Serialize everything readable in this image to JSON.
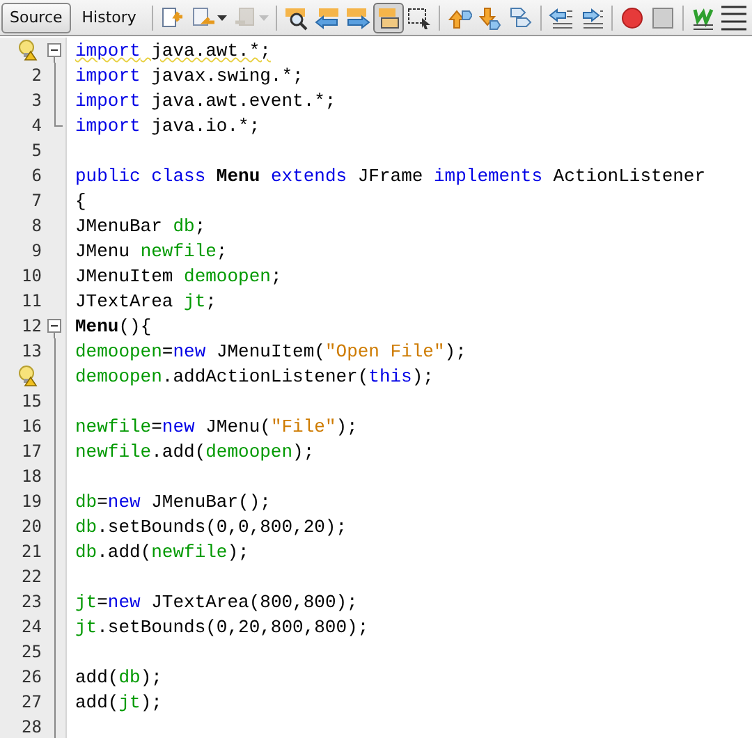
{
  "tabs": [
    {
      "label": "Source",
      "selected": true
    },
    {
      "label": "History",
      "selected": false
    }
  ],
  "toolbar": [
    {
      "kind": "button",
      "disabled": false,
      "selected": false
    },
    {
      "kind": "dropdown",
      "disabled": false,
      "selected": false
    },
    {
      "kind": "dropdown",
      "disabled": true,
      "selected": false
    },
    {
      "kind": "separator"
    },
    {
      "kind": "button",
      "disabled": false,
      "selected": false
    },
    {
      "kind": "button",
      "disabled": false,
      "selected": false
    },
    {
      "kind": "button",
      "disabled": false,
      "selected": false
    },
    {
      "kind": "button",
      "disabled": false,
      "selected": true
    },
    {
      "kind": "button",
      "disabled": false,
      "selected": false
    },
    {
      "kind": "separator"
    },
    {
      "kind": "button",
      "disabled": false,
      "selected": false
    },
    {
      "kind": "button",
      "disabled": false,
      "selected": false
    },
    {
      "kind": "button",
      "disabled": false,
      "selected": false
    },
    {
      "kind": "separator"
    },
    {
      "kind": "button",
      "disabled": false,
      "selected": false
    },
    {
      "kind": "button",
      "disabled": false,
      "selected": false
    },
    {
      "kind": "separator"
    },
    {
      "kind": "button",
      "disabled": false,
      "selected": false
    },
    {
      "kind": "button",
      "disabled": false,
      "selected": false
    },
    {
      "kind": "separator"
    },
    {
      "kind": "button",
      "disabled": false,
      "selected": false
    },
    {
      "kind": "button",
      "disabled": false,
      "selected": false
    }
  ],
  "lines": [
    {
      "hint": true,
      "fold_open": true,
      "warning": true,
      "tokens": [
        {
          "kind": "keyword",
          "text": "import"
        },
        {
          "kind": "plain",
          "text": " java.awt.*;"
        }
      ]
    },
    {
      "number": "2",
      "fold_guide": true,
      "tokens": [
        {
          "kind": "keyword",
          "text": "import"
        },
        {
          "kind": "plain",
          "text": " javax.swing.*;"
        }
      ]
    },
    {
      "number": "3",
      "fold_guide": true,
      "tokens": [
        {
          "kind": "keyword",
          "text": "import"
        },
        {
          "kind": "plain",
          "text": " java.awt.event.*;"
        }
      ]
    },
    {
      "number": "4",
      "fold_end": true,
      "tokens": [
        {
          "kind": "keyword",
          "text": "import"
        },
        {
          "kind": "plain",
          "text": " java.io.*;"
        }
      ]
    },
    {
      "number": "5"
    },
    {
      "number": "6",
      "tokens": [
        {
          "kind": "keyword",
          "text": "public class "
        },
        {
          "kind": "bold",
          "text": "Menu"
        },
        {
          "kind": "keyword",
          "text": " extends"
        },
        {
          "kind": "plain",
          "text": " JFrame "
        },
        {
          "kind": "keyword",
          "text": "implements"
        },
        {
          "kind": "plain",
          "text": " ActionListener"
        }
      ]
    },
    {
      "number": "7",
      "tokens": [
        {
          "kind": "plain",
          "text": "{"
        }
      ]
    },
    {
      "number": "8",
      "tokens": [
        {
          "kind": "plain",
          "text": "JMenuBar "
        },
        {
          "kind": "field",
          "text": "db"
        },
        {
          "kind": "plain",
          "text": ";"
        }
      ]
    },
    {
      "number": "9",
      "tokens": [
        {
          "kind": "plain",
          "text": "JMenu "
        },
        {
          "kind": "field",
          "text": "newfile"
        },
        {
          "kind": "plain",
          "text": ";"
        }
      ]
    },
    {
      "number": "10",
      "tokens": [
        {
          "kind": "plain",
          "text": "JMenuItem "
        },
        {
          "kind": "field",
          "text": "demoopen"
        },
        {
          "kind": "plain",
          "text": ";"
        }
      ]
    },
    {
      "number": "11",
      "tokens": [
        {
          "kind": "plain",
          "text": "JTextArea "
        },
        {
          "kind": "field",
          "text": "jt"
        },
        {
          "kind": "plain",
          "text": ";"
        }
      ]
    },
    {
      "number": "12",
      "fold_open": true,
      "tokens": [
        {
          "kind": "bold",
          "text": "Menu"
        },
        {
          "kind": "plain",
          "text": "(){"
        }
      ]
    },
    {
      "number": "13",
      "fold_guide": true,
      "tokens": [
        {
          "kind": "field",
          "text": "demoopen"
        },
        {
          "kind": "plain",
          "text": "="
        },
        {
          "kind": "keyword",
          "text": "new"
        },
        {
          "kind": "plain",
          "text": " JMenuItem("
        },
        {
          "kind": "string",
          "text": "\"Open File\""
        },
        {
          "kind": "plain",
          "text": ");"
        }
      ]
    },
    {
      "hint": true,
      "fold_guide": true,
      "tokens": [
        {
          "kind": "field",
          "text": "demoopen"
        },
        {
          "kind": "plain",
          "text": ".addActionListener("
        },
        {
          "kind": "keyword",
          "text": "this"
        },
        {
          "kind": "plain",
          "text": ");"
        }
      ]
    },
    {
      "number": "15",
      "fold_guide": true
    },
    {
      "number": "16",
      "fold_guide": true,
      "tokens": [
        {
          "kind": "field",
          "text": "newfile"
        },
        {
          "kind": "plain",
          "text": "="
        },
        {
          "kind": "keyword",
          "text": "new"
        },
        {
          "kind": "plain",
          "text": " JMenu("
        },
        {
          "kind": "string",
          "text": "\"File\""
        },
        {
          "kind": "plain",
          "text": ");"
        }
      ]
    },
    {
      "number": "17",
      "fold_guide": true,
      "tokens": [
        {
          "kind": "field",
          "text": "newfile"
        },
        {
          "kind": "plain",
          "text": ".add("
        },
        {
          "kind": "field",
          "text": "demoopen"
        },
        {
          "kind": "plain",
          "text": ");"
        }
      ]
    },
    {
      "number": "18",
      "fold_guide": true
    },
    {
      "number": "19",
      "fold_guide": true,
      "tokens": [
        {
          "kind": "field",
          "text": "db"
        },
        {
          "kind": "plain",
          "text": "="
        },
        {
          "kind": "keyword",
          "text": "new"
        },
        {
          "kind": "plain",
          "text": " JMenuBar();"
        }
      ]
    },
    {
      "number": "20",
      "fold_guide": true,
      "tokens": [
        {
          "kind": "field",
          "text": "db"
        },
        {
          "kind": "plain",
          "text": ".setBounds(0,0,800,20);"
        }
      ]
    },
    {
      "number": "21",
      "fold_guide": true,
      "tokens": [
        {
          "kind": "field",
          "text": "db"
        },
        {
          "kind": "plain",
          "text": ".add("
        },
        {
          "kind": "field",
          "text": "newfile"
        },
        {
          "kind": "plain",
          "text": ");"
        }
      ]
    },
    {
      "number": "22",
      "fold_guide": true
    },
    {
      "number": "23",
      "fold_guide": true,
      "tokens": [
        {
          "kind": "field",
          "text": "jt"
        },
        {
          "kind": "plain",
          "text": "="
        },
        {
          "kind": "keyword",
          "text": "new"
        },
        {
          "kind": "plain",
          "text": " JTextArea(800,800);"
        }
      ]
    },
    {
      "number": "24",
      "fold_guide": true,
      "tokens": [
        {
          "kind": "field",
          "text": "jt"
        },
        {
          "kind": "plain",
          "text": ".setBounds(0,20,800,800);"
        }
      ]
    },
    {
      "number": "25",
      "fold_guide": true
    },
    {
      "number": "26",
      "fold_guide": true,
      "tokens": [
        {
          "kind": "plain",
          "text": "add("
        },
        {
          "kind": "field",
          "text": "db"
        },
        {
          "kind": "plain",
          "text": ");"
        }
      ]
    },
    {
      "number": "27",
      "fold_guide": true,
      "tokens": [
        {
          "kind": "plain",
          "text": "add("
        },
        {
          "kind": "field",
          "text": "jt"
        },
        {
          "kind": "plain",
          "text": ");"
        }
      ]
    },
    {
      "number": "28",
      "fold_guide": true
    }
  ]
}
